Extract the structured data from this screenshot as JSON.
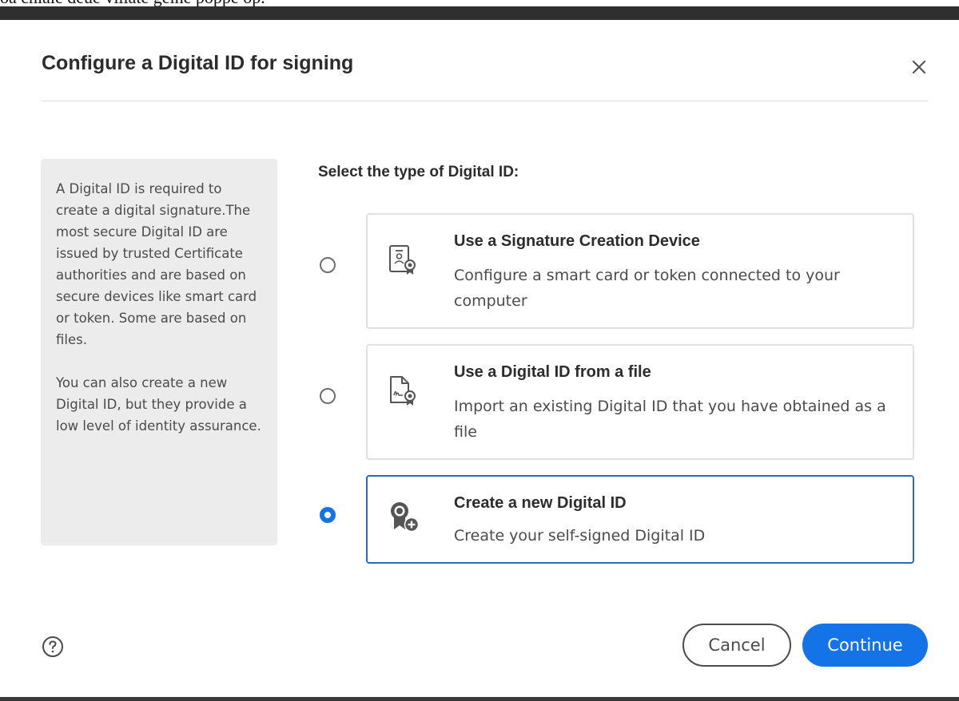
{
  "background_text": "oa chiale deue villate gelhe poppe op.",
  "dialog": {
    "title": "Configure a Digital ID for signing",
    "close_icon": "close-icon",
    "info_panel": {
      "paragraph1": "A Digital ID is required to create a digital signature.The most secure Digital ID are issued by trusted Certificate authorities and are based on secure devices like smart card or token. Some are based on files.",
      "paragraph2": "You can also create a new Digital ID, but they provide a low level of identity assurance."
    },
    "select_label": "Select the type of Digital ID:",
    "options": [
      {
        "title": "Use a Signature Creation Device",
        "description": "Configure a smart card or token connected to your computer",
        "icon": "signature-device-icon",
        "selected": false
      },
      {
        "title": "Use a Digital ID from a file",
        "description": "Import an existing Digital ID that you have obtained as a file",
        "icon": "digital-id-file-icon",
        "selected": false
      },
      {
        "title": "Create a new Digital ID",
        "description": "Create your self-signed Digital ID",
        "icon": "new-digital-id-icon",
        "selected": true
      }
    ],
    "help_icon": "help-icon",
    "cancel_label": "Cancel",
    "continue_label": "Continue"
  },
  "colors": {
    "accent": "#1473e6",
    "selected_border": "#2e6cba",
    "panel_bg": "#ececec",
    "card_border": "#e1e1e1"
  }
}
